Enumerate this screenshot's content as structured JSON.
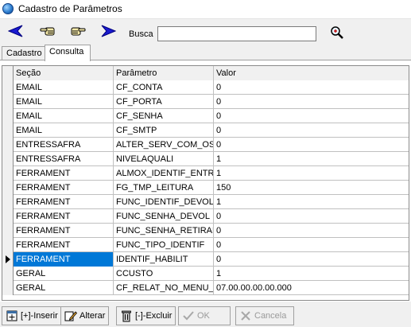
{
  "window": {
    "title": "Cadastro de Parâmetros"
  },
  "toolbar": {
    "first_icon": "arrow-left-icon",
    "prev_icon": "hand-pointing-left-icon",
    "next_icon": "hand-pointing-right-icon",
    "last_icon": "arrow-right-icon",
    "search_label": "Busca",
    "search_value": "",
    "search_icon": "magnifier-icon"
  },
  "tabs": [
    {
      "label": "Cadastro",
      "active": false
    },
    {
      "label": "Consulta",
      "active": true
    }
  ],
  "grid": {
    "columns": [
      "Seção",
      "Parâmetro",
      "Valor"
    ],
    "rows": [
      {
        "secao": "EMAIL",
        "parametro": "CF_CONTA",
        "valor": "0"
      },
      {
        "secao": "EMAIL",
        "parametro": "CF_PORTA",
        "valor": "0"
      },
      {
        "secao": "EMAIL",
        "parametro": "CF_SENHA",
        "valor": "0"
      },
      {
        "secao": "EMAIL",
        "parametro": "CF_SMTP",
        "valor": "0"
      },
      {
        "secao": "ENTRESSAFRA",
        "parametro": "ALTER_SERV_COM_OS",
        "valor": "0"
      },
      {
        "secao": "ENTRESSAFRA",
        "parametro": "NIVELAQUALI",
        "valor": "1"
      },
      {
        "secao": "FERRAMENT",
        "parametro": "ALMOX_IDENTIF_ENTR",
        "valor": "1"
      },
      {
        "secao": "FERRAMENT",
        "parametro": "FG_TMP_LEITURA",
        "valor": "150"
      },
      {
        "secao": "FERRAMENT",
        "parametro": "FUNC_IDENTIF_DEVOL",
        "valor": "1"
      },
      {
        "secao": "FERRAMENT",
        "parametro": "FUNC_SENHA_DEVOL",
        "valor": "0"
      },
      {
        "secao": "FERRAMENT",
        "parametro": "FUNC_SENHA_RETIRAD",
        "valor": "0"
      },
      {
        "secao": "FERRAMENT",
        "parametro": "FUNC_TIPO_IDENTIF",
        "valor": "0"
      },
      {
        "secao": "FERRAMENT",
        "parametro": "IDENTIF_HABILIT",
        "valor": "0",
        "selected": true
      },
      {
        "secao": "GERAL",
        "parametro": "CCUSTO",
        "valor": "1"
      },
      {
        "secao": "GERAL",
        "parametro": "CF_RELAT_NO_MENU_I",
        "valor": "07.00.00.00.00.000"
      }
    ],
    "highlight_color": "#d00000",
    "selection_color": "#0078d7"
  },
  "buttons": {
    "inserir": {
      "label": "[+]-Inserir",
      "icon": "insert-icon",
      "enabled": true
    },
    "alterar": {
      "label": "Alterar",
      "icon": "edit-icon",
      "enabled": true
    },
    "excluir": {
      "label": "[-]-Excluir",
      "icon": "trash-icon",
      "enabled": true
    },
    "ok": {
      "label": "OK",
      "icon": "check-icon",
      "enabled": false
    },
    "cancela": {
      "label": "Cancela",
      "icon": "x-icon",
      "enabled": false
    }
  }
}
